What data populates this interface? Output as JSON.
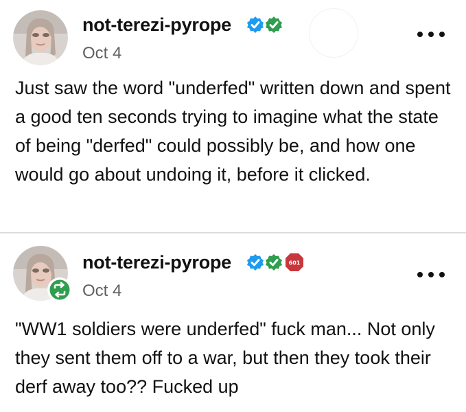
{
  "posts": [
    {
      "username": "not-terezi-pyrope",
      "date": "Oct 4",
      "body": "Just saw the word \"underfed\" written down and spent a good ten seconds trying to imagine what the state of being \"derfed\" could possibly be, and how one would go about undoing it, before it clicked.",
      "badges": [
        "verified-check-icon",
        "green-check-icon"
      ],
      "more_icon": "more-options-icon"
    },
    {
      "username": "not-terezi-pyrope",
      "date": "Oct 4",
      "body": "\"WW1 soldiers were underfed\" fuck man... Not only they sent them off to a war, but then they took their derf away too?? Fucked up",
      "badges": [
        "verified-check-icon",
        "green-check-icon",
        "red-count-badge"
      ],
      "red_badge_text": "601",
      "reblog_icon": "reblog-icon",
      "more_icon": "more-options-icon"
    }
  ],
  "colors": {
    "verified_blue": "#1d9bf0",
    "check_green": "#2e9e4f",
    "badge_red": "#c8373b",
    "date_gray": "#5f5f5f"
  }
}
